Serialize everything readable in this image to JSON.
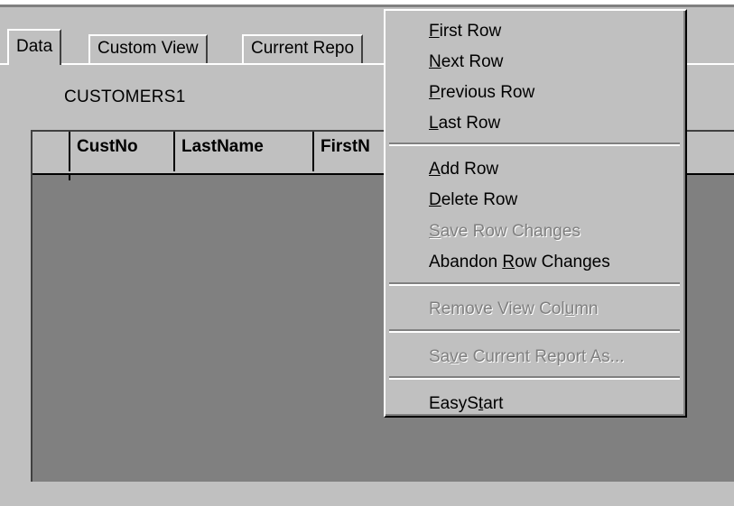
{
  "tabs": [
    {
      "label": "Data",
      "active": true
    },
    {
      "label": "Custom View",
      "active": false
    },
    {
      "label": "Current Repo",
      "active": false
    }
  ],
  "dataset_label": "CUSTOMERS1",
  "grid": {
    "columns": [
      "CustNo",
      "LastName",
      "FirstN"
    ]
  },
  "context_menu": {
    "items": [
      {
        "pre": "",
        "key": "F",
        "post": "irst Row",
        "enabled": true
      },
      {
        "pre": "",
        "key": "N",
        "post": "ext Row",
        "enabled": true
      },
      {
        "pre": "",
        "key": "P",
        "post": "revious Row",
        "enabled": true
      },
      {
        "pre": "",
        "key": "L",
        "post": "ast Row",
        "enabled": true
      },
      {
        "pre": "",
        "key": "A",
        "post": "dd Row",
        "enabled": true
      },
      {
        "pre": "",
        "key": "D",
        "post": "elete Row",
        "enabled": true
      },
      {
        "pre": "",
        "key": "S",
        "post": "ave Row Changes",
        "enabled": false
      },
      {
        "pre": "Abandon ",
        "key": "R",
        "post": "ow Changes",
        "enabled": true
      },
      {
        "pre": "Remove View Col",
        "key": "u",
        "post": "mn",
        "enabled": false
      },
      {
        "pre": "Sa",
        "key": "v",
        "post": "e Current Report As...",
        "enabled": false
      },
      {
        "pre": "EasyS",
        "key": "t",
        "post": "art",
        "enabled": true
      }
    ]
  },
  "colors": {
    "face": "#c0c0c0",
    "grid_background": "#808080",
    "disabled_text": "#808080"
  }
}
